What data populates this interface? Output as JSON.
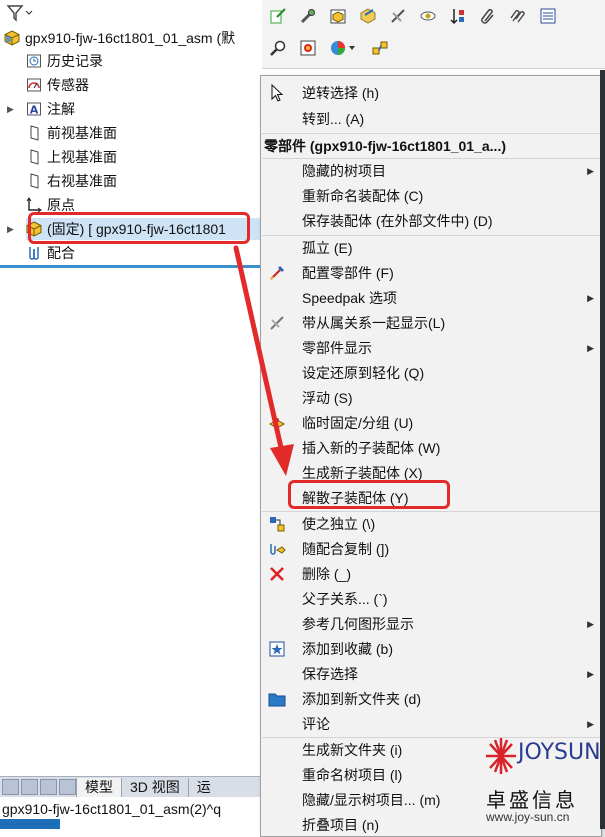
{
  "tree": {
    "root_label": "gpx910-fjw-16ct1801_01_asm (默",
    "items": [
      {
        "label": "历史记录",
        "icon": "history-icon"
      },
      {
        "label": "传感器",
        "icon": "sensor-icon"
      },
      {
        "label": "注解",
        "icon": "annotation-icon"
      },
      {
        "label": "前视基准面",
        "icon": "plane-icon"
      },
      {
        "label": "上视基准面",
        "icon": "plane-icon"
      },
      {
        "label": "右视基准面",
        "icon": "plane-icon"
      },
      {
        "label": "原点",
        "icon": "origin-icon"
      },
      {
        "label": "(固定) [ gpx910-fjw-16ct1801",
        "icon": "part-icon"
      },
      {
        "label": "配合",
        "icon": "mate-icon"
      }
    ]
  },
  "tabs": {
    "model": "模型",
    "view3d": "3D 视图",
    "more": "运"
  },
  "status": {
    "text": "gpx910-fjw-16ct1801_01_asm(2)^q"
  },
  "menu": {
    "items": [
      {
        "label": "逆转选择 (h)",
        "icon": "cursor-icon"
      },
      {
        "label": "转到... (A)"
      },
      {
        "label": "零部件 (gpx910-fjw-16ct1801_01_a...)",
        "header": true
      },
      {
        "label": "隐藏的树项目",
        "submenu": true
      },
      {
        "label": "重新命名装配体 (C)"
      },
      {
        "label": "保存装配体 (在外部文件中) (D)"
      },
      {
        "label": "孤立 (E)"
      },
      {
        "label": "配置零部件 (F)",
        "icon": "configure-icon"
      },
      {
        "label": "Speedpak 选项",
        "submenu": true
      },
      {
        "label": "带从属关系一起显示(L)",
        "icon": "show-dependents-icon"
      },
      {
        "label": "零部件显示",
        "submenu": true
      },
      {
        "label": "设定还原到轻化 (Q)"
      },
      {
        "label": "浮动 (S)"
      },
      {
        "label": "临时固定/分组 (U)",
        "icon": "fix-group-icon"
      },
      {
        "label": "插入新的子装配体 (W)"
      },
      {
        "label": "生成新子装配体 (X)"
      },
      {
        "label": "解散子装配体 (Y)"
      },
      {
        "label": "使之独立 (\\)",
        "icon": "independent-icon"
      },
      {
        "label": "随配合复制 (])",
        "icon": "copy-mates-icon"
      },
      {
        "label": "删除 (_)",
        "icon": "delete-icon"
      },
      {
        "label": "父子关系... (`)"
      },
      {
        "label": "参考几何图形显示",
        "submenu": true
      },
      {
        "label": "添加到收藏 (b)",
        "icon": "favorite-icon"
      },
      {
        "label": "保存选择",
        "submenu": true
      },
      {
        "label": "添加到新文件夹 (d)",
        "icon": "folder-icon"
      },
      {
        "label": "评论",
        "submenu": true
      },
      {
        "label": "生成新文件夹 (i)"
      },
      {
        "label": "重命名树项目 (l)"
      },
      {
        "label": "隐藏/显示树项目... (m)"
      },
      {
        "label": "折叠项目 (n)"
      }
    ]
  },
  "logo": {
    "name": "JOYSUN",
    "cn": "卓盛信息",
    "url": "www.joy-sun.cn"
  },
  "colors": {
    "highlight": "#e32a2a",
    "accent": "#3b8ed0",
    "logo_red": "#d8232a",
    "logo_blue": "#2a3c8f"
  }
}
